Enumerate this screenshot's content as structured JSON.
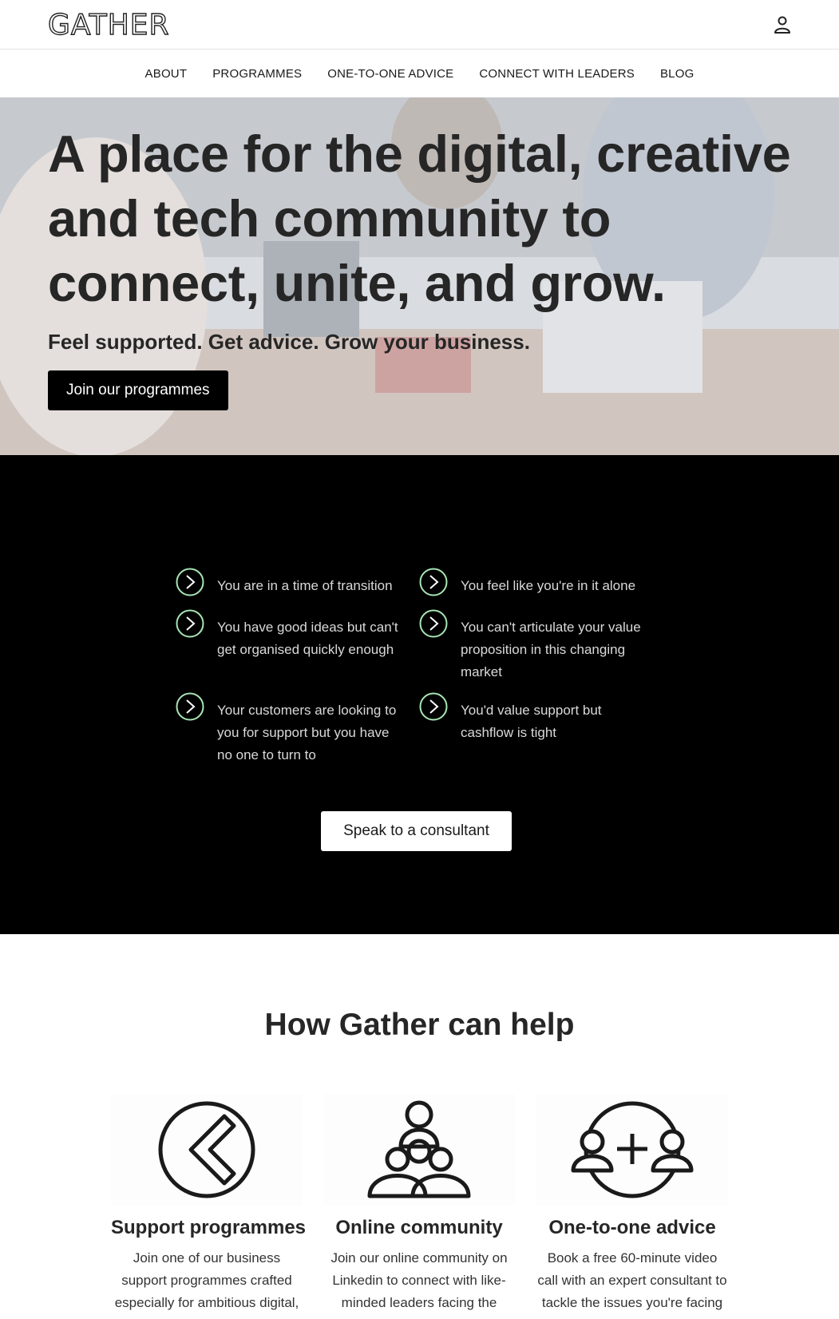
{
  "header": {
    "logo_text": "GATHER",
    "nav": [
      "ABOUT",
      "PROGRAMMES",
      "ONE-TO-ONE ADVICE",
      "CONNECT WITH LEADERS",
      "BLOG"
    ]
  },
  "hero": {
    "title": "A place for the digital, creative and tech community to connect, unite, and grow.",
    "subtitle": "Feel supported. Get advice. Grow your business.",
    "cta": "Join our programmes"
  },
  "problems": {
    "items": [
      "You are in a time of transition",
      "You feel like you're in it alone",
      "You have good ideas but can't get organised quickly enough",
      "You can't articulate your value proposition in this changing market",
      "Your customers are looking to you for support but you have no one to turn to",
      "You'd value support but cashflow is tight"
    ],
    "cta": "Speak to a consultant",
    "accent_color": "#a8e6b5"
  },
  "help": {
    "title": "How Gather can help",
    "cards": [
      {
        "title": "Support programmes",
        "text": "Join one of our business support programmes crafted especially for ambitious digital, creative and tech leaders in"
      },
      {
        "title": "Online community",
        "text": "Join our online community on Linkedin to connect with like-minded leaders facing the same issues as you"
      },
      {
        "title": "One-to-one advice",
        "text": "Book a free 60-minute video call with an expert consultant to tackle the issues you're facing"
      }
    ]
  }
}
